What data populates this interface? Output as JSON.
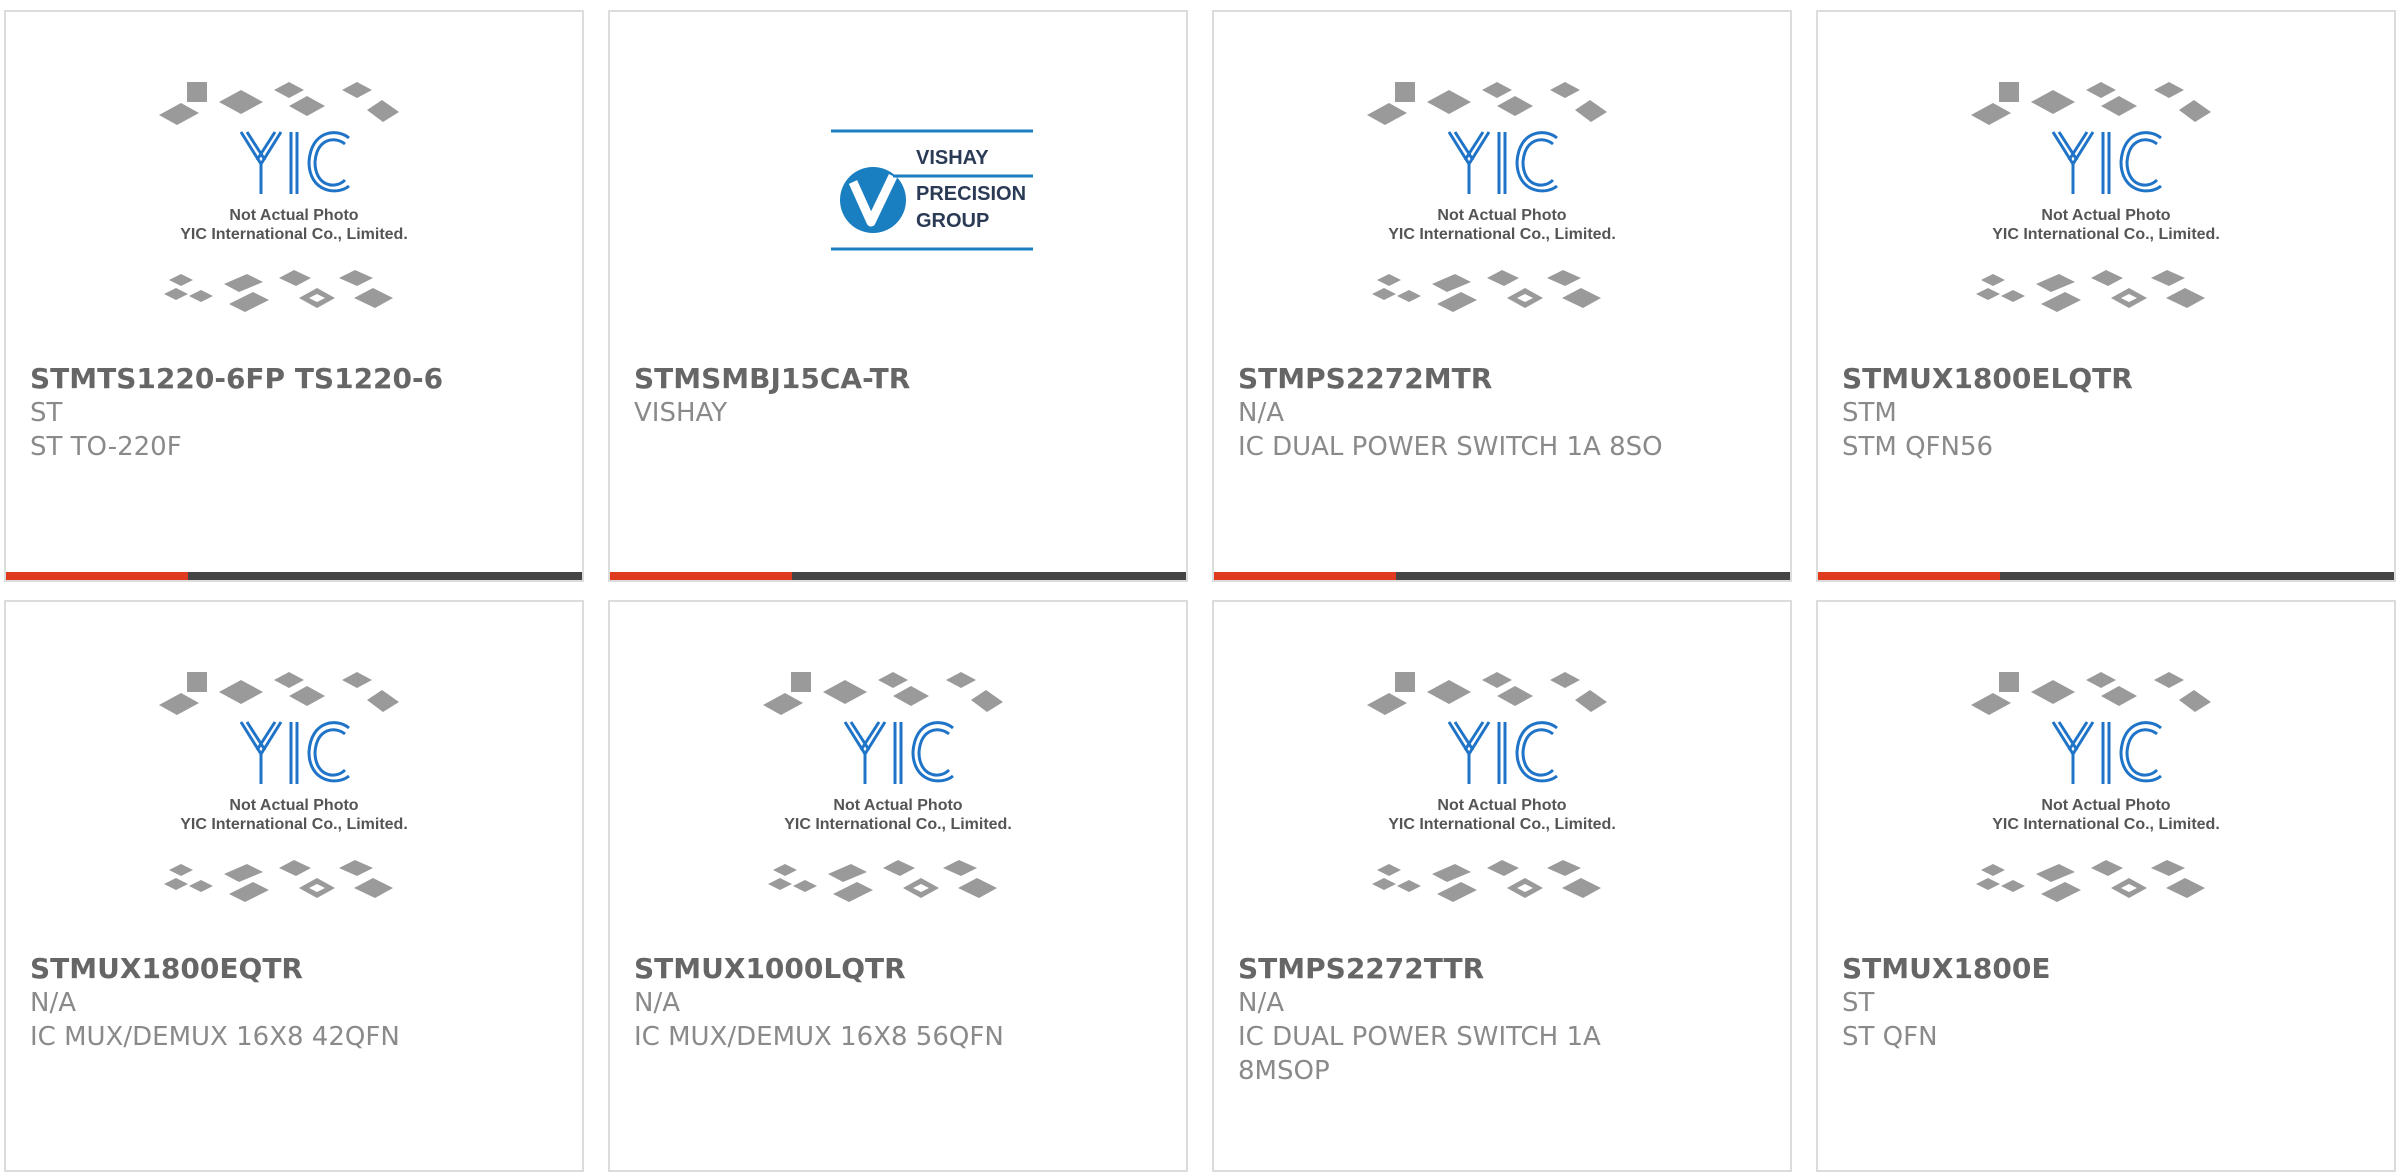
{
  "colors": {
    "accent": "#e03a1e",
    "bar": "#444444",
    "yic_blue": "#1f74c8",
    "vishay_blue": "#1a7fc1"
  },
  "placeholder": {
    "line1": "Not Actual Photo",
    "line2": "YIC International Co., Limited."
  },
  "vishay_logo": {
    "line1": "VISHAY",
    "line2": "PRECISION",
    "line3": "GROUP"
  },
  "products": [
    {
      "part_number": "STMTS1220-6FP TS1220-6",
      "manufacturer": "ST",
      "description": "ST TO-220F",
      "image": "yic-placeholder"
    },
    {
      "part_number": "STMSMBJ15CA-TR",
      "manufacturer": "VISHAY",
      "description": "",
      "image": "vishay-logo"
    },
    {
      "part_number": "STMPS2272MTR",
      "manufacturer": "N/A",
      "description": "IC DUAL POWER SWITCH 1A 8SO",
      "image": "yic-placeholder"
    },
    {
      "part_number": "STMUX1800ELQTR",
      "manufacturer": "STM",
      "description": "STM QFN56",
      "image": "yic-placeholder"
    },
    {
      "part_number": "STMUX1800EQTR",
      "manufacturer": "N/A",
      "description": "IC MUX/DEMUX 16X8 42QFN",
      "image": "yic-placeholder"
    },
    {
      "part_number": "STMUX1000LQTR",
      "manufacturer": "N/A",
      "description": "IC MUX/DEMUX 16X8 56QFN",
      "image": "yic-placeholder"
    },
    {
      "part_number": "STMPS2272TTR",
      "manufacturer": "N/A",
      "description": "IC DUAL POWER SWITCH 1A\n8MSOP",
      "image": "yic-placeholder"
    },
    {
      "part_number": "STMUX1800E",
      "manufacturer": "ST",
      "description": "ST QFN",
      "image": "yic-placeholder"
    }
  ]
}
